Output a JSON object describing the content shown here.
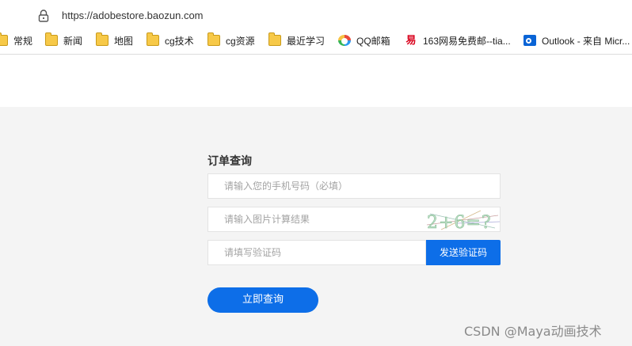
{
  "browser": {
    "url": "https://adobestore.baozun.com"
  },
  "bookmarks": [
    {
      "label": "常规",
      "icon": "folder-icon"
    },
    {
      "label": "新闻",
      "icon": "folder-icon"
    },
    {
      "label": "地图",
      "icon": "folder-icon"
    },
    {
      "label": "cg技术",
      "icon": "folder-icon"
    },
    {
      "label": "cg资源",
      "icon": "folder-icon"
    },
    {
      "label": "最近学习",
      "icon": "folder-icon"
    },
    {
      "label": "QQ邮箱",
      "icon": "qq-mail-icon"
    },
    {
      "label": "163网易免费邮--tia...",
      "icon": "netease-163-icon"
    },
    {
      "label": "Outlook - 来自 Micr...",
      "icon": "outlook-icon"
    }
  ],
  "form": {
    "title": "订单查询",
    "phone_placeholder": "请输入您的手机号码（必填）",
    "captcha_placeholder": "请输入图片计算结果",
    "code_placeholder": "请填写验证码",
    "captcha_text": "2+6=?",
    "send_code_label": "发送验证码",
    "submit_label": "立即查询"
  },
  "watermark": "CSDN @Maya动画技术",
  "colors": {
    "primary_button": "#0d6ee8",
    "page_background": "#f4f4f4"
  }
}
